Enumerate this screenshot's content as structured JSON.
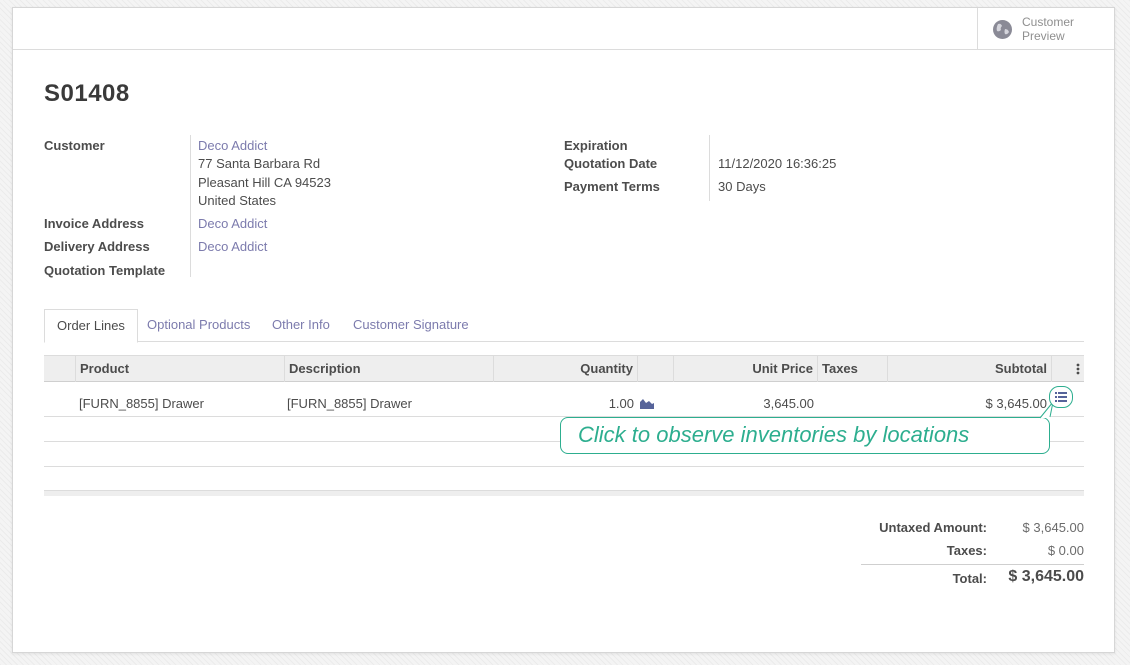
{
  "header": {
    "preview_label": "Customer Preview",
    "preview_icon": "globe-icon"
  },
  "record": {
    "title": "S01408"
  },
  "fields": {
    "customer_label": "Customer",
    "customer_name": "Deco Addict",
    "customer_street": "77 Santa Barbara Rd",
    "customer_city": "Pleasant Hill CA 94523",
    "customer_country": "United States",
    "invoice_label": "Invoice Address",
    "invoice_value": "Deco Addict",
    "delivery_label": "Delivery Address",
    "delivery_value": "Deco Addict",
    "template_label": "Quotation Template",
    "template_value": "",
    "expiration_label": "Expiration",
    "expiration_value": "",
    "qdate_label": "Quotation Date",
    "qdate_value": "11/12/2020 16:36:25",
    "terms_label": "Payment Terms",
    "terms_value": "30 Days"
  },
  "tabs": [
    "Order Lines",
    "Optional Products",
    "Other Info",
    "Customer Signature"
  ],
  "table": {
    "headers": {
      "product": "Product",
      "description": "Description",
      "quantity": "Quantity",
      "unit_price": "Unit Price",
      "taxes": "Taxes",
      "subtotal": "Subtotal"
    },
    "rows": [
      {
        "product": "[FURN_8855] Drawer",
        "description": "[FURN_8855] Drawer",
        "quantity": "1.00",
        "unit_price": "3,645.00",
        "taxes": "",
        "subtotal": "$ 3,645.00"
      }
    ]
  },
  "tooltip": {
    "text": "Click to observe inventories by locations"
  },
  "totals": {
    "untaxed_label": "Untaxed Amount:",
    "untaxed_value": "$ 3,645.00",
    "taxes_label": "Taxes:",
    "taxes_value": "$ 0.00",
    "total_label": "Total:",
    "total_value": "$ 3,645.00"
  },
  "colors": {
    "link": "#7c7bad",
    "accent": "#2dae8f"
  }
}
